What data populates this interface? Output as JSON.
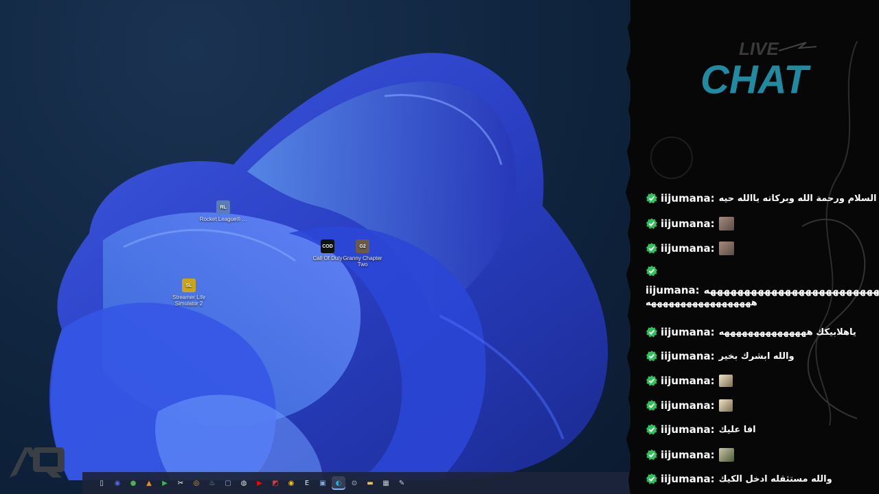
{
  "desktop": {
    "icons": [
      {
        "label": "Rocket League® ...",
        "glyph": "RL",
        "color": "#5b7cb8"
      },
      {
        "label": "Call Of Duty",
        "glyph": "COD",
        "color": "#111111"
      },
      {
        "label": "Granny Chapter Two",
        "glyph": "G2",
        "color": "#6b5a48"
      },
      {
        "label": "Streamer Life Simulator 2",
        "glyph": "SL",
        "color": "#c9a51c"
      }
    ],
    "logo_text": "AQ"
  },
  "taskbar": {
    "apps": [
      {
        "name": "file-icon",
        "glyph": "▯",
        "color": "#d9d9d9"
      },
      {
        "name": "discord-icon",
        "glyph": "◉",
        "color": "#5865f2"
      },
      {
        "name": "chat-app-icon",
        "glyph": "●",
        "color": "#4caf50"
      },
      {
        "name": "vlc-icon",
        "glyph": "▲",
        "color": "#f08c1a"
      },
      {
        "name": "play-icon",
        "glyph": "▶",
        "color": "#3fb34f"
      },
      {
        "name": "capcut-icon",
        "glyph": "✂",
        "color": "#ffffff"
      },
      {
        "name": "orange-app-icon",
        "glyph": "◎",
        "color": "#f4a12a"
      },
      {
        "name": "steam-icon",
        "glyph": "♨",
        "color": "#9bb3d1"
      },
      {
        "name": "window-icon",
        "glyph": "▢",
        "color": "#8fb0e0"
      },
      {
        "name": "obs-icon",
        "glyph": "◍",
        "color": "#e0e0e0"
      },
      {
        "name": "youtube-icon",
        "glyph": "▶",
        "color": "#ff0000"
      },
      {
        "name": "red-app-icon",
        "glyph": "◩",
        "color": "#e23b3b"
      },
      {
        "name": "chrome-icon",
        "glyph": "◉",
        "color": "#f4c20d"
      },
      {
        "name": "epic-games-icon",
        "glyph": "E",
        "color": "#e8e8e8"
      },
      {
        "name": "photos-icon",
        "glyph": "▣",
        "color": "#87a8d8"
      },
      {
        "name": "edge-icon",
        "glyph": "◐",
        "color": "#2fa7e0"
      },
      {
        "name": "media-player-icon",
        "glyph": "⊙",
        "color": "#cfcfcf"
      },
      {
        "name": "folder-icon",
        "glyph": "▬",
        "color": "#f5c542"
      },
      {
        "name": "store-icon",
        "glyph": "▦",
        "color": "#c9c9c9"
      },
      {
        "name": "notepad-icon",
        "glyph": "✎",
        "color": "#d0d0d0"
      }
    ]
  },
  "chat": {
    "header": "LIVE CHAT",
    "messages": [
      {
        "user": "iijumana:",
        "text": "بكم السلام ورحمة الله وبركاته ياالله حيه",
        "emote": ""
      },
      {
        "user": "iijumana:",
        "text": "",
        "emote": "face"
      },
      {
        "user": "iijumana:",
        "text": "",
        "emote": "face"
      },
      {
        "user": "iijumana:",
        "text": "",
        "emote": ""
      },
      {
        "user": "iijumana:",
        "text": "ياهلابيكك هههههههههههههههه",
        "emote": ""
      },
      {
        "user": "iijumana:",
        "text": "والله ابشرك بخير",
        "emote": ""
      },
      {
        "user": "iijumana:",
        "text": "",
        "emote": "small"
      },
      {
        "user": "iijumana:",
        "text": "",
        "emote": "small"
      },
      {
        "user": "iijumana:",
        "text": "افا عليك",
        "emote": ""
      },
      {
        "user": "iijumana:",
        "text": "",
        "emote": "pic"
      },
      {
        "user": "iijumana:",
        "text": "والله مستثقله ادخل الكيك",
        "emote": ""
      }
    ],
    "long_message": {
      "user": "iijumana:",
      "line1": "ههههههههههههههههههههههههههههههههههههه",
      "line2": "ههههههههههههههههههه"
    }
  }
}
